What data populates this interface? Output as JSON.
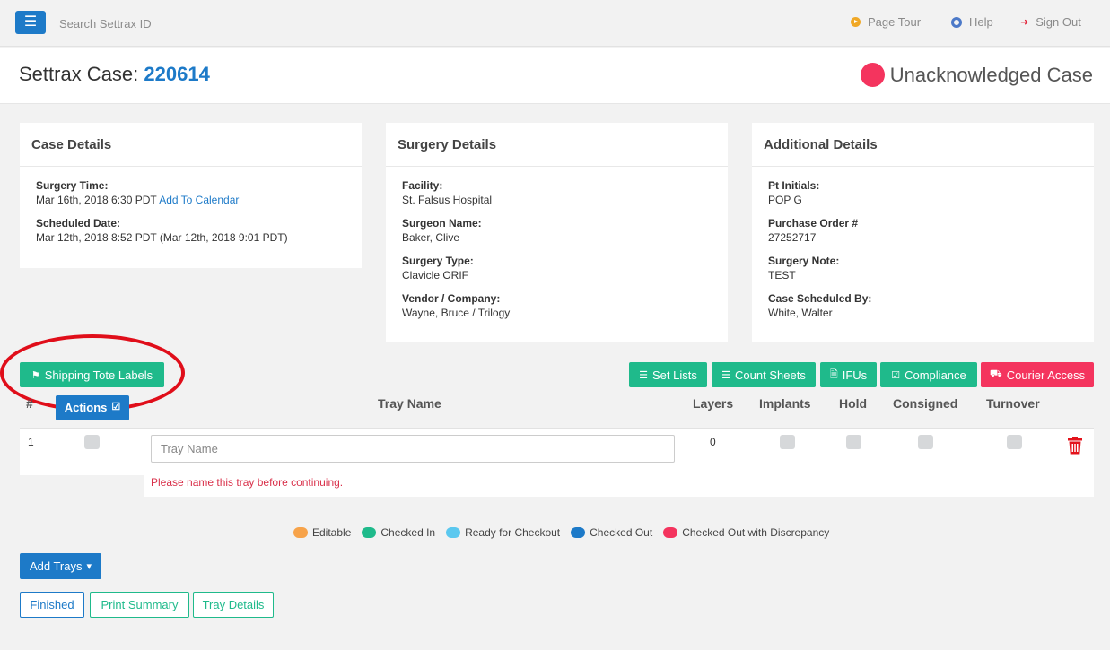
{
  "nav": {
    "search_placeholder": "Search Settrax ID",
    "page_tour": "Page Tour",
    "help": "Help",
    "sign_out": "Sign Out"
  },
  "header": {
    "case_label": "Settrax Case:",
    "case_number": "220614",
    "status": "Unacknowledged Case",
    "status_color": "#f4345e"
  },
  "case_details": {
    "title": "Case Details",
    "surgery_time_label": "Surgery Time:",
    "surgery_time": "Mar 16th, 2018 6:30 PDT",
    "add_to_calendar": "Add To Calendar",
    "scheduled_date_label": "Scheduled Date:",
    "scheduled_date": "Mar 12th, 2018 8:52 PDT (Mar 12th, 2018 9:01 PDT)"
  },
  "surgery_details": {
    "title": "Surgery Details",
    "fields": [
      {
        "label": "Facility:",
        "value": "St. Falsus Hospital"
      },
      {
        "label": "Surgeon Name:",
        "value": "Baker, Clive"
      },
      {
        "label": "Surgery Type:",
        "value": "Clavicle ORIF"
      },
      {
        "label": "Vendor / Company:",
        "value": "Wayne, Bruce / Trilogy"
      }
    ]
  },
  "additional_details": {
    "title": "Additional Details",
    "fields": [
      {
        "label": "Pt Initials:",
        "value": "POP G"
      },
      {
        "label": "Purchase Order #",
        "value": "27252717"
      },
      {
        "label": "Surgery Note:",
        "value": "TEST"
      },
      {
        "label": "Case Scheduled By:",
        "value": "White, Walter"
      }
    ]
  },
  "toolbar": {
    "shipping_tote_labels": "Shipping Tote Labels",
    "set_lists": "Set Lists",
    "count_sheets": "Count Sheets",
    "ifus": "IFUs",
    "compliance": "Compliance",
    "courier_access": "Courier Access"
  },
  "table": {
    "headers": {
      "num": "#",
      "actions": "Actions",
      "tray_name": "Tray Name",
      "layers": "Layers",
      "implants": "Implants",
      "hold": "Hold",
      "consigned": "Consigned",
      "turnover": "Turnover"
    },
    "rows": [
      {
        "num": "1",
        "tray_name_value": "",
        "tray_name_placeholder": "Tray Name",
        "layers": "0",
        "error": "Please name this tray before continuing."
      }
    ]
  },
  "legend": [
    {
      "label": "Editable",
      "color": "#f7a34a"
    },
    {
      "label": "Checked In",
      "color": "#1fba8b"
    },
    {
      "label": "Ready for Checkout",
      "color": "#5bc8ef"
    },
    {
      "label": "Checked Out",
      "color": "#1d7ac8"
    },
    {
      "label": "Checked Out with Discrepancy",
      "color": "#f4345e"
    }
  ],
  "footer": {
    "add_trays": "Add Trays",
    "finished": "Finished",
    "print_summary": "Print Summary",
    "tray_details": "Tray Details"
  },
  "colors": {
    "primary": "#1d7ac8",
    "success": "#1fba8b",
    "danger": "#f4345e"
  }
}
